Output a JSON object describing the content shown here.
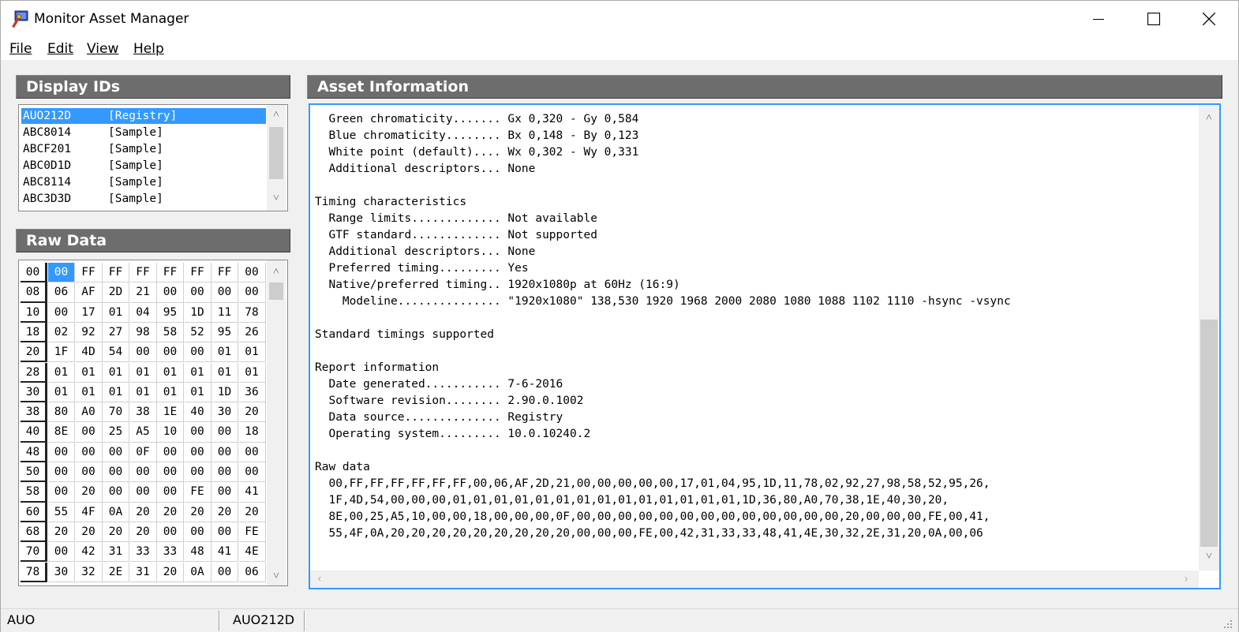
{
  "window": {
    "title": "Monitor Asset Manager"
  },
  "menu": [
    {
      "label": "File"
    },
    {
      "label": "Edit"
    },
    {
      "label": "View"
    },
    {
      "label": "Help"
    }
  ],
  "display_ids": {
    "title": "Display IDs",
    "items": [
      {
        "id": "AUO212D",
        "source": "[Registry]",
        "selected": true
      },
      {
        "id": "ABC8014",
        "source": "[Sample]"
      },
      {
        "id": "ABCF201",
        "source": "[Sample]"
      },
      {
        "id": "ABC0D1D",
        "source": "[Sample]"
      },
      {
        "id": "ABC8114",
        "source": "[Sample]"
      },
      {
        "id": "ABC3D3D",
        "source": "[Sample]"
      }
    ]
  },
  "raw_data": {
    "title": "Raw Data",
    "rows": [
      {
        "offset": "00",
        "bytes": [
          "00",
          "FF",
          "FF",
          "FF",
          "FF",
          "FF",
          "FF",
          "00"
        ]
      },
      {
        "offset": "08",
        "bytes": [
          "06",
          "AF",
          "2D",
          "21",
          "00",
          "00",
          "00",
          "00"
        ]
      },
      {
        "offset": "10",
        "bytes": [
          "00",
          "17",
          "01",
          "04",
          "95",
          "1D",
          "11",
          "78"
        ]
      },
      {
        "offset": "18",
        "bytes": [
          "02",
          "92",
          "27",
          "98",
          "58",
          "52",
          "95",
          "26"
        ]
      },
      {
        "offset": "20",
        "bytes": [
          "1F",
          "4D",
          "54",
          "00",
          "00",
          "00",
          "01",
          "01"
        ]
      },
      {
        "offset": "28",
        "bytes": [
          "01",
          "01",
          "01",
          "01",
          "01",
          "01",
          "01",
          "01"
        ]
      },
      {
        "offset": "30",
        "bytes": [
          "01",
          "01",
          "01",
          "01",
          "01",
          "01",
          "1D",
          "36"
        ]
      },
      {
        "offset": "38",
        "bytes": [
          "80",
          "A0",
          "70",
          "38",
          "1E",
          "40",
          "30",
          "20"
        ]
      },
      {
        "offset": "40",
        "bytes": [
          "8E",
          "00",
          "25",
          "A5",
          "10",
          "00",
          "00",
          "18"
        ]
      },
      {
        "offset": "48",
        "bytes": [
          "00",
          "00",
          "00",
          "0F",
          "00",
          "00",
          "00",
          "00"
        ]
      },
      {
        "offset": "50",
        "bytes": [
          "00",
          "00",
          "00",
          "00",
          "00",
          "00",
          "00",
          "00"
        ]
      },
      {
        "offset": "58",
        "bytes": [
          "00",
          "20",
          "00",
          "00",
          "00",
          "FE",
          "00",
          "41"
        ]
      },
      {
        "offset": "60",
        "bytes": [
          "55",
          "4F",
          "0A",
          "20",
          "20",
          "20",
          "20",
          "20"
        ]
      },
      {
        "offset": "68",
        "bytes": [
          "20",
          "20",
          "20",
          "20",
          "00",
          "00",
          "00",
          "FE"
        ]
      },
      {
        "offset": "70",
        "bytes": [
          "00",
          "42",
          "31",
          "33",
          "33",
          "48",
          "41",
          "4E"
        ]
      },
      {
        "offset": "78",
        "bytes": [
          "30",
          "32",
          "2E",
          "31",
          "20",
          "0A",
          "00",
          "06"
        ]
      }
    ]
  },
  "asset_info": {
    "title": "Asset Information",
    "lines": [
      "  Green chromaticity....... Gx 0,320 - Gy 0,584",
      "  Blue chromaticity........ Bx 0,148 - By 0,123",
      "  White point (default).... Wx 0,302 - Wy 0,331",
      "  Additional descriptors... None",
      "",
      "Timing characteristics",
      "  Range limits............. Not available",
      "  GTF standard............. Not supported",
      "  Additional descriptors... None",
      "  Preferred timing......... Yes",
      "  Native/preferred timing.. 1920x1080p at 60Hz (16:9)",
      "    Modeline............... \"1920x1080\" 138,530 1920 1968 2000 2080 1080 1088 1102 1110 -hsync -vsync",
      "",
      "Standard timings supported",
      "",
      "Report information",
      "  Date generated........... 7-6-2016",
      "  Software revision........ 2.90.0.1002",
      "  Data source.............. Registry",
      "  Operating system......... 10.0.10240.2",
      "",
      "Raw data",
      "  00,FF,FF,FF,FF,FF,FF,00,06,AF,2D,21,00,00,00,00,00,17,01,04,95,1D,11,78,02,92,27,98,58,52,95,26,",
      "  1F,4D,54,00,00,00,01,01,01,01,01,01,01,01,01,01,01,01,01,01,1D,36,80,A0,70,38,1E,40,30,20,",
      "  8E,00,25,A5,10,00,00,18,00,00,00,0F,00,00,00,00,00,00,00,00,00,00,00,00,00,20,00,00,00,FE,00,41,",
      "  55,4F,0A,20,20,20,20,20,20,20,20,20,00,00,00,FE,00,42,31,33,33,48,41,4E,30,32,2E,31,20,0A,00,06"
    ]
  },
  "status": {
    "manufacturer": "AUO",
    "display_id": "AUO212D"
  },
  "colors": {
    "accent": "#3399ff",
    "header_bg": "#6d6d6d",
    "focus_border": "#3399ff"
  }
}
